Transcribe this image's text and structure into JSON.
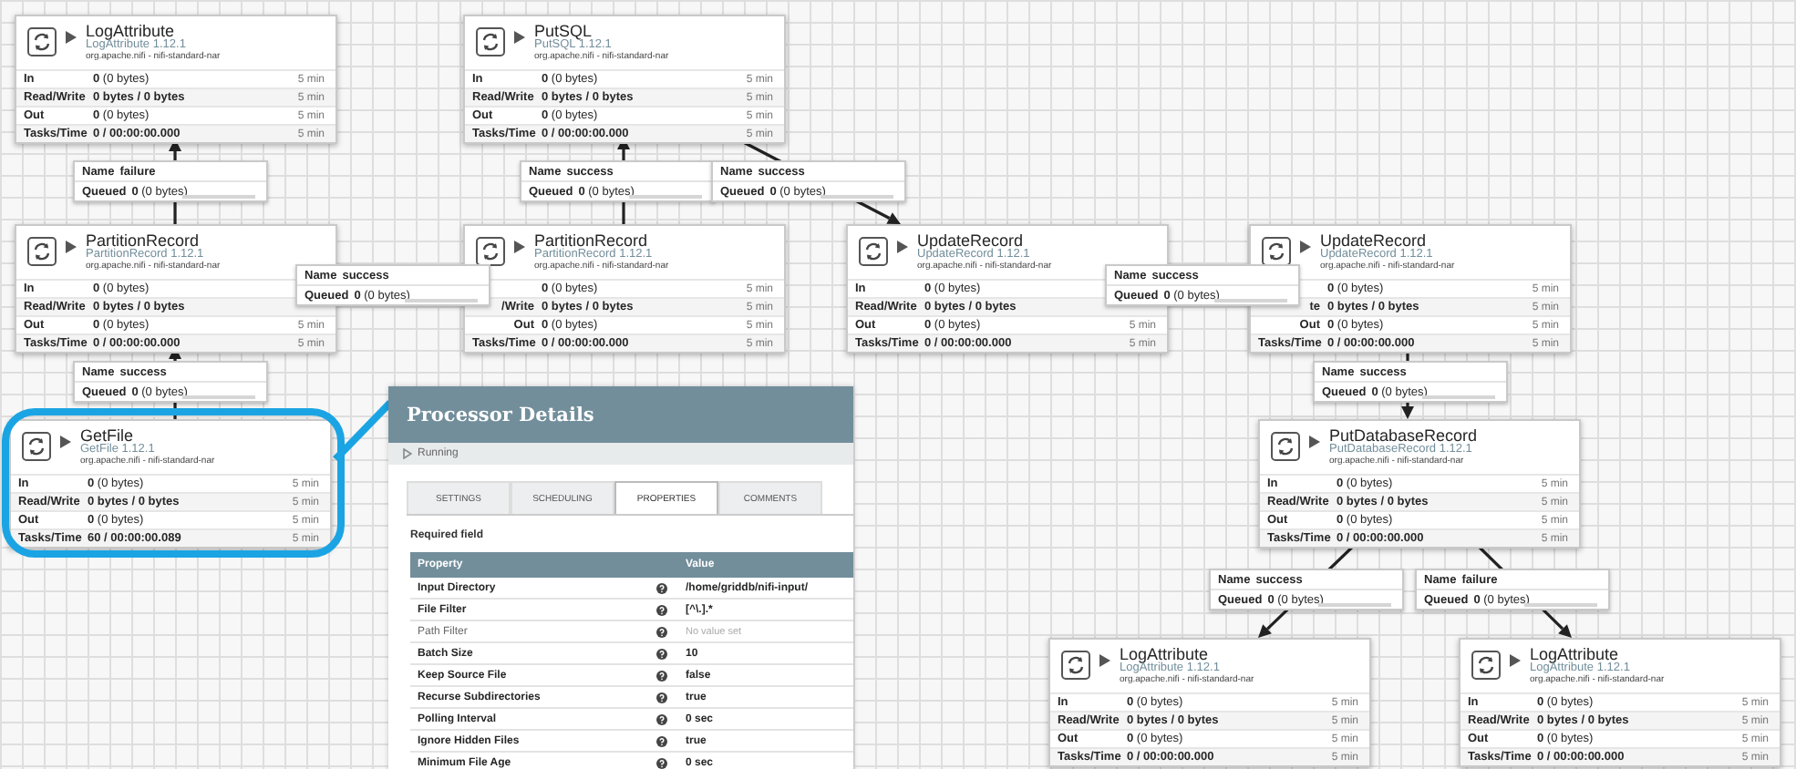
{
  "canvas": {
    "processors": [
      {
        "name": "LogAttribute",
        "type_version": "LogAttribute 1.12.1",
        "bundle": "org.apache.nifi - nifi-standard-nar",
        "highlighted": false,
        "stats": [
          {
            "label": "In",
            "value": "**0** (0 bytes)",
            "window": "5 min"
          },
          {
            "label": "Read/Write",
            "value": "0 bytes / 0 bytes",
            "window": "5 min"
          },
          {
            "label": "Out",
            "value": "**0** (0 bytes)",
            "window": "5 min"
          },
          {
            "label": "Tasks/Time",
            "value": "0 / 00:00:00.000",
            "window": "5 min"
          }
        ]
      },
      {
        "name": "PutSQL",
        "type_version": "PutSQL 1.12.1",
        "bundle": "org.apache.nifi - nifi-standard-nar",
        "highlighted": false,
        "stats": [
          {
            "label": "In",
            "value": "**0** (0 bytes)",
            "window": "5 min"
          },
          {
            "label": "Read/Write",
            "value": "0 bytes / 0 bytes",
            "window": "5 min"
          },
          {
            "label": "Out",
            "value": "**0** (0 bytes)",
            "window": "5 min"
          },
          {
            "label": "Tasks/Time",
            "value": "0 / 00:00:00.000",
            "window": "5 min"
          }
        ]
      },
      {
        "name": "PartitionRecord",
        "type_version": "PartitionRecord 1.12.1",
        "bundle": "org.apache.nifi - nifi-standard-nar",
        "highlighted": false,
        "stats": [
          {
            "label": "In",
            "value": "**0** (0 bytes)"
          },
          {
            "label": "Read/Write",
            "value": "0 bytes / 0 bytes"
          },
          {
            "label": "Out",
            "value": "**0** (0 bytes)",
            "window": "5 min"
          },
          {
            "label": "Tasks/Time",
            "value": "0 / 00:00:00.000",
            "window": "5 min"
          }
        ]
      },
      {
        "name": "PartitionRecord",
        "type_version": "PartitionRecord 1.12.1",
        "bundle": "org.apache.nifi - nifi-standard-nar",
        "highlighted": false,
        "stats": [
          {
            "value": "**0** (0 bytes)",
            "window": "5 min"
          },
          {
            "label": "/Write",
            "value": "0 bytes / 0 bytes",
            "window": "5 min"
          },
          {
            "label": "Out",
            "value": "**0** (0 bytes)",
            "window": "5 min"
          },
          {
            "label": "Tasks/Time",
            "value": "0 / 00:00:00.000",
            "window": "5 min"
          }
        ]
      },
      {
        "name": "UpdateRecord",
        "type_version": "UpdateRecord 1.12.1",
        "bundle": "org.apache.nifi - nifi-standard-nar",
        "highlighted": false,
        "stats": [
          {
            "label": "In",
            "value": "**0** (0 bytes)"
          },
          {
            "label": "Read/Write",
            "value": "0 bytes / 0 bytes"
          },
          {
            "label": "Out",
            "value": "**0** (0 bytes)",
            "window": "5 min"
          },
          {
            "label": "Tasks/Time",
            "value": "0 / 00:00:00.000",
            "window": "5 min"
          }
        ]
      },
      {
        "name": "UpdateRecord",
        "type_version": "UpdateRecord 1.12.1",
        "bundle": "org.apache.nifi - nifi-standard-nar",
        "highlighted": false,
        "stats": [
          {
            "value": "**0** (0 bytes)",
            "window": "5 min"
          },
          {
            "label": "te",
            "value": "0 bytes / 0 bytes",
            "window": "5 min"
          },
          {
            "label": "Out",
            "value": "**0** (0 bytes)",
            "window": "5 min"
          },
          {
            "label": "Tasks/Time",
            "value": "0 / 00:00:00.000",
            "window": "5 min"
          }
        ]
      },
      {
        "name": "GetFile",
        "type_version": "GetFile 1.12.1",
        "bundle": "org.apache.nifi - nifi-standard-nar",
        "highlighted": true,
        "stats": [
          {
            "label": "In",
            "value": "**0** (0 bytes)",
            "window": "5 min"
          },
          {
            "label": "Read/Write",
            "value": "0 bytes / 0 bytes",
            "window": "5 min"
          },
          {
            "label": "Out",
            "value": "**0** (0 bytes)",
            "window": "5 min"
          },
          {
            "label": "Tasks/Time",
            "value": "60 / 00:00:00.089",
            "window": "5 min"
          }
        ]
      },
      {
        "name": "PutDatabaseRecord",
        "type_version": "PutDatabaseRecord 1.12.1",
        "bundle": "org.apache.nifi - nifi-standard-nar",
        "highlighted": false,
        "stats": [
          {
            "label": "In",
            "value": "**0** (0 bytes)",
            "window": "5 min"
          },
          {
            "label": "Read/Write",
            "value": "0 bytes / 0 bytes",
            "window": "5 min"
          },
          {
            "label": "Out",
            "value": "**0** (0 bytes)",
            "window": "5 min"
          },
          {
            "label": "Tasks/Time",
            "value": "0 / 00:00:00.000",
            "window": "5 min"
          }
        ]
      },
      {
        "name": "LogAttribute",
        "type_version": "LogAttribute 1.12.1",
        "bundle": "org.apache.nifi - nifi-standard-nar",
        "highlighted": false,
        "stats": [
          {
            "label": "In",
            "value": "**0** (0 bytes)",
            "window": "5 min"
          },
          {
            "label": "Read/Write",
            "value": "0 bytes / 0 bytes",
            "window": "5 min"
          },
          {
            "label": "Out",
            "value": "**0** (0 bytes)",
            "window": "5 min"
          },
          {
            "label": "Tasks/Time",
            "value": "0 / 00:00:00.000",
            "window": "5 min"
          }
        ]
      },
      {
        "name": "LogAttribute",
        "type_version": "LogAttribute 1.12.1",
        "bundle": "org.apache.nifi - nifi-standard-nar",
        "highlighted": false,
        "stats": [
          {
            "label": "In",
            "value": "**0** (0 bytes)",
            "window": "5 min"
          },
          {
            "label": "Read/Write",
            "value": "0 bytes / 0 bytes",
            "window": "5 min"
          },
          {
            "label": "Out",
            "value": "**0** (0 bytes)",
            "window": "5 min"
          },
          {
            "label": "Tasks/Time",
            "value": "0 / 00:00:00.000",
            "window": "5 min"
          }
        ]
      }
    ],
    "connections": [
      {
        "name_label": "Name",
        "name": "failure",
        "queued_label": "Queued",
        "queued": "**0** (0 bytes)"
      },
      {
        "name_label": "Name",
        "name": "success",
        "queued_label": "Queued",
        "queued": "**0** (0 bytes)"
      },
      {
        "name_label": "Name",
        "name": "success",
        "queued_label": "Queued",
        "queued": "**0** (0 bytes)"
      },
      {
        "name_label": "Name",
        "name": "success",
        "queued_label": "Queued",
        "queued": "**0** (0 bytes)"
      },
      {
        "name_label": "Name",
        "name": "success",
        "queued_label": "Queued",
        "queued": "**0** (0 bytes)"
      },
      {
        "name_label": "Name",
        "name": "success",
        "queued_label": "Queued",
        "queued": "**0** (0 bytes)"
      },
      {
        "name_label": "Name",
        "name": "success",
        "queued_label": "Queued",
        "queued": "**0** (0 bytes)"
      },
      {
        "name_label": "Name",
        "name": "success",
        "queued_label": "Queued",
        "queued": "**0** (0 bytes)"
      },
      {
        "name_label": "Name",
        "name": "failure",
        "queued_label": "Queued",
        "queued": "**0** (0 bytes)"
      }
    ]
  },
  "processor_details": {
    "title": "Processor Details",
    "status": "Running",
    "tabs": [
      {
        "label": "SETTINGS",
        "selected": false
      },
      {
        "label": "SCHEDULING",
        "selected": false
      },
      {
        "label": "PROPERTIES",
        "selected": true
      },
      {
        "label": "COMMENTS",
        "selected": false
      }
    ],
    "note": "Required field",
    "columns": [
      "Property",
      "Value"
    ],
    "rows": [
      {
        "property": "Input Directory",
        "required": true,
        "value": "/home/griddb/nifi-input/",
        "value_set": true
      },
      {
        "property": "File Filter",
        "required": true,
        "value": "[^\\.].*",
        "value_set": true
      },
      {
        "property": "Path Filter",
        "required": false,
        "value": "No value set",
        "value_set": false
      },
      {
        "property": "Batch Size",
        "required": true,
        "value": "10",
        "value_set": true
      },
      {
        "property": "Keep Source File",
        "required": true,
        "value": "false",
        "value_set": true
      },
      {
        "property": "Recurse Subdirectories",
        "required": true,
        "value": "true",
        "value_set": true
      },
      {
        "property": "Polling Interval",
        "required": true,
        "value": "0 sec",
        "value_set": true
      },
      {
        "property": "Ignore Hidden Files",
        "required": true,
        "value": "true",
        "value_set": true
      },
      {
        "property": "Minimum File Age",
        "required": true,
        "value": "0 sec",
        "value_set": true
      }
    ]
  }
}
